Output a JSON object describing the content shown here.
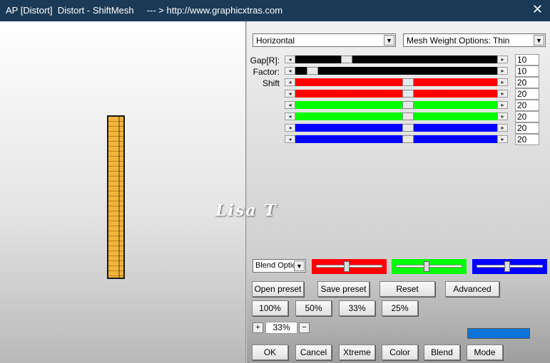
{
  "window": {
    "title": "AP [Distort]  Distort - ShiftMesh     --- > http://www.graphicxtras.com",
    "close_glyph": "✕"
  },
  "controls": {
    "direction_dropdown": "Horizontal",
    "mesh_weight_dropdown": "Mesh Weight Options: Thin",
    "labels": {
      "gap": "Gap[R]:",
      "factor": "Factor:",
      "shift": "Shift"
    },
    "sliders": [
      {
        "value": "10",
        "color": "#000000",
        "level": 0.24
      },
      {
        "value": "10",
        "color": "#000000",
        "level": 0.06
      },
      {
        "value": "20",
        "color": "#ff0000",
        "level": 0.56
      },
      {
        "value": "20",
        "color": "#ff0000",
        "level": 0.56
      },
      {
        "value": "20",
        "color": "#00ff00",
        "level": 0.56
      },
      {
        "value": "20",
        "color": "#00ff00",
        "level": 0.56
      },
      {
        "value": "20",
        "color": "#0000ff",
        "level": 0.56
      },
      {
        "value": "20",
        "color": "#0000ff",
        "level": 0.56
      }
    ],
    "blend_options": "Blend Optio",
    "color_sliders": [
      {
        "color": "#ff0000",
        "level": 0.46
      },
      {
        "color": "#00ff00",
        "level": 0.46
      },
      {
        "color": "#0000ff",
        "level": 0.46
      }
    ],
    "buttons_row1": [
      "Open preset",
      "Save preset",
      "Reset",
      "Advanced"
    ],
    "zoom_buttons": [
      "100%",
      "50%",
      "33%",
      "25%"
    ],
    "zoom": {
      "plus": "+",
      "value": "33%",
      "minus": "−"
    },
    "swatch_color": "#0a73d9",
    "buttons_bottom": [
      "OK",
      "Cancel",
      "Xtreme",
      "Color",
      "Blend",
      "Mode"
    ]
  },
  "watermark": "Lisa  T"
}
